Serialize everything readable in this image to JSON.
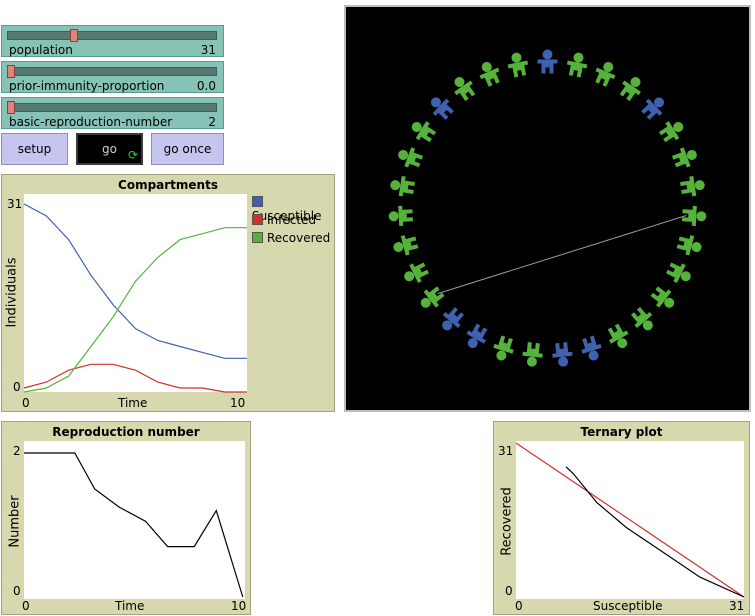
{
  "colors": {
    "susceptible": "#3e62b0",
    "infected": "#d2302b",
    "recovered": "#55b33b"
  },
  "sliders": [
    {
      "label": "population",
      "value": "31",
      "fraction": 0.31
    },
    {
      "label": "prior-immunity-proportion",
      "value": "0.0",
      "fraction": 0.0
    },
    {
      "label": "basic-reproduction-number",
      "value": "2",
      "fraction": 0.0
    }
  ],
  "buttons": {
    "setup": "setup",
    "go": "go",
    "go_once": "go once"
  },
  "icons": {
    "forever": "forever-arrows-icon",
    "person": "person-icon"
  },
  "view": {
    "agent_count": 31,
    "blue_indices": [
      0,
      4,
      14,
      15,
      18,
      19,
      27
    ]
  },
  "compartments": {
    "title": "Compartments",
    "ylabel": "Individuals",
    "xlabel": "Time",
    "legend": [
      "Susceptible",
      "Infected",
      "Recovered"
    ]
  },
  "reproduction": {
    "title": "Reproduction number",
    "ylabel": "Number",
    "xlabel": "Time"
  },
  "ternary": {
    "title": "Ternary plot",
    "ylabel": "Recovered",
    "xlabel": "Susceptible"
  },
  "chart_data": [
    {
      "type": "line",
      "title": "Compartments",
      "xlabel": "Time",
      "ylabel": "Individuals",
      "xlim": [
        0,
        10
      ],
      "ylim": [
        0,
        31
      ],
      "x": [
        0,
        1,
        2,
        3,
        4,
        5,
        6,
        7,
        8,
        9,
        10
      ],
      "series": [
        {
          "name": "Susceptible",
          "values": [
            31,
            29,
            25,
            19,
            14,
            10,
            8,
            7,
            6,
            5,
            5
          ]
        },
        {
          "name": "Infected",
          "values": [
            0,
            1,
            3,
            4,
            4,
            3,
            1,
            0,
            0,
            -1,
            -1
          ]
        },
        {
          "name": "Recovered",
          "values": [
            -1,
            0,
            2,
            7,
            12,
            18,
            22,
            25,
            26,
            27,
            27
          ]
        }
      ],
      "x_ticks": [
        "0",
        "10"
      ],
      "y_ticks": [
        "0",
        "31"
      ]
    },
    {
      "type": "line",
      "title": "Reproduction number",
      "xlabel": "Time",
      "ylabel": "Number",
      "xlim": [
        0,
        10
      ],
      "ylim": [
        0,
        2
      ],
      "x": [
        0,
        2.3,
        3.2,
        4.3,
        5.5,
        6.5,
        7.7,
        8.7,
        9.9
      ],
      "series": [
        {
          "values": [
            2.0,
            2.0,
            1.5,
            1.25,
            1.05,
            0.7,
            0.7,
            1.2,
            0.0
          ]
        }
      ],
      "x_ticks": [
        "0",
        "10"
      ],
      "y_ticks": [
        "0",
        "2"
      ]
    },
    {
      "type": "line",
      "title": "Ternary plot",
      "xlabel": "Susceptible",
      "ylabel": "Recovered",
      "xlim": [
        0,
        31
      ],
      "ylim": [
        0,
        31
      ],
      "series": [
        {
          "x": [
            0,
            31
          ],
          "y": [
            31,
            0
          ]
        },
        {
          "x": [
            6.8,
            7.8,
            11,
            15,
            20,
            25,
            31
          ],
          "y": [
            26.2,
            24.8,
            19,
            14,
            9,
            4,
            0
          ]
        }
      ],
      "x_ticks": [
        "0",
        "31"
      ],
      "y_ticks": [
        "0",
        "31"
      ]
    }
  ]
}
